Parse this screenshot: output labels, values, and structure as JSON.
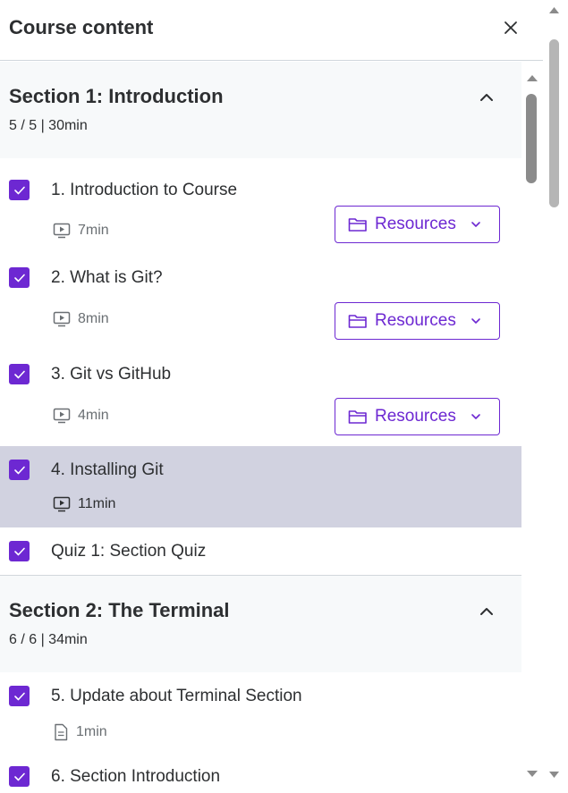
{
  "header": {
    "title": "Course content"
  },
  "sections": [
    {
      "title": "Section 1: Introduction",
      "meta": "5 / 5 | 30min",
      "items": [
        {
          "title": "1. Introduction to Course",
          "duration": "7min",
          "type": "video",
          "checked": true,
          "resources": "Resources"
        },
        {
          "title": "2. What is Git?",
          "duration": "8min",
          "type": "video",
          "checked": true,
          "resources": "Resources"
        },
        {
          "title": "3. Git vs GitHub",
          "duration": "4min",
          "type": "video",
          "checked": true,
          "resources": "Resources"
        },
        {
          "title": "4. Installing Git",
          "duration": "11min",
          "type": "video",
          "checked": true,
          "active": true
        },
        {
          "title": "Quiz 1: Section Quiz",
          "checked": true,
          "type": "quiz"
        }
      ]
    },
    {
      "title": "Section 2: The Terminal",
      "meta": "6 / 6 | 34min",
      "items": [
        {
          "title": "5. Update about Terminal Section",
          "duration": "1min",
          "type": "article",
          "checked": true
        },
        {
          "title": "6. Section Introduction",
          "checked": true,
          "type": "video"
        }
      ]
    }
  ],
  "colors": {
    "accent": "#6d28d2",
    "active_row": "#d1d2e0",
    "section_bg": "#f7f9fa"
  },
  "icons": {
    "close": "close-icon",
    "collapse": "chevron-up-icon",
    "video": "video-icon",
    "article": "file-icon",
    "folder": "folder-icon",
    "dropdown": "chevron-down-icon",
    "check": "check-icon"
  }
}
